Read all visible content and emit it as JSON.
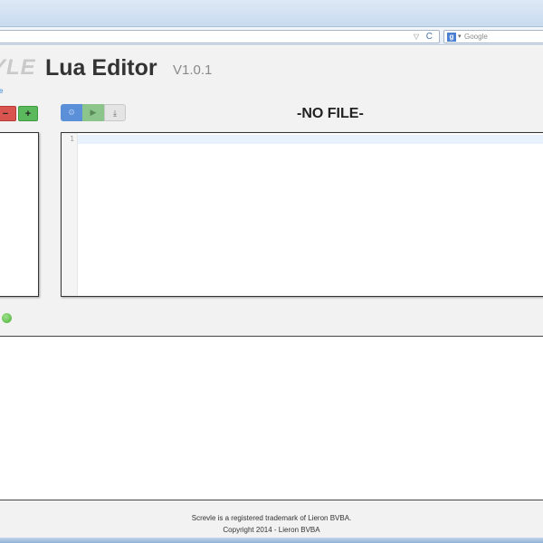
{
  "browser": {
    "search_placeholder": "Google",
    "search_engine_glyph": "g",
    "url_dropdown_glyph": "▽",
    "reload_glyph": "C",
    "search_caret_glyph": "▾"
  },
  "header": {
    "logo_text": "YLE",
    "title": "Lua Editor",
    "version": "V1.0.1",
    "link_text": "e"
  },
  "file_buttons": {
    "remove_label": "−",
    "add_label": "+"
  },
  "toolbar": {
    "settings_glyph": "⚙",
    "run_glyph": "▶",
    "download_glyph": "⤓"
  },
  "editor": {
    "file_name": "-NO FILE-",
    "line_numbers": [
      "1"
    ]
  },
  "status": {
    "color": "#4caf3a"
  },
  "footer": {
    "trademark": "Screvle is a registered trademark of Lieron BVBA.",
    "copyright": "Copyright 2014 - Lieron BVBA"
  }
}
